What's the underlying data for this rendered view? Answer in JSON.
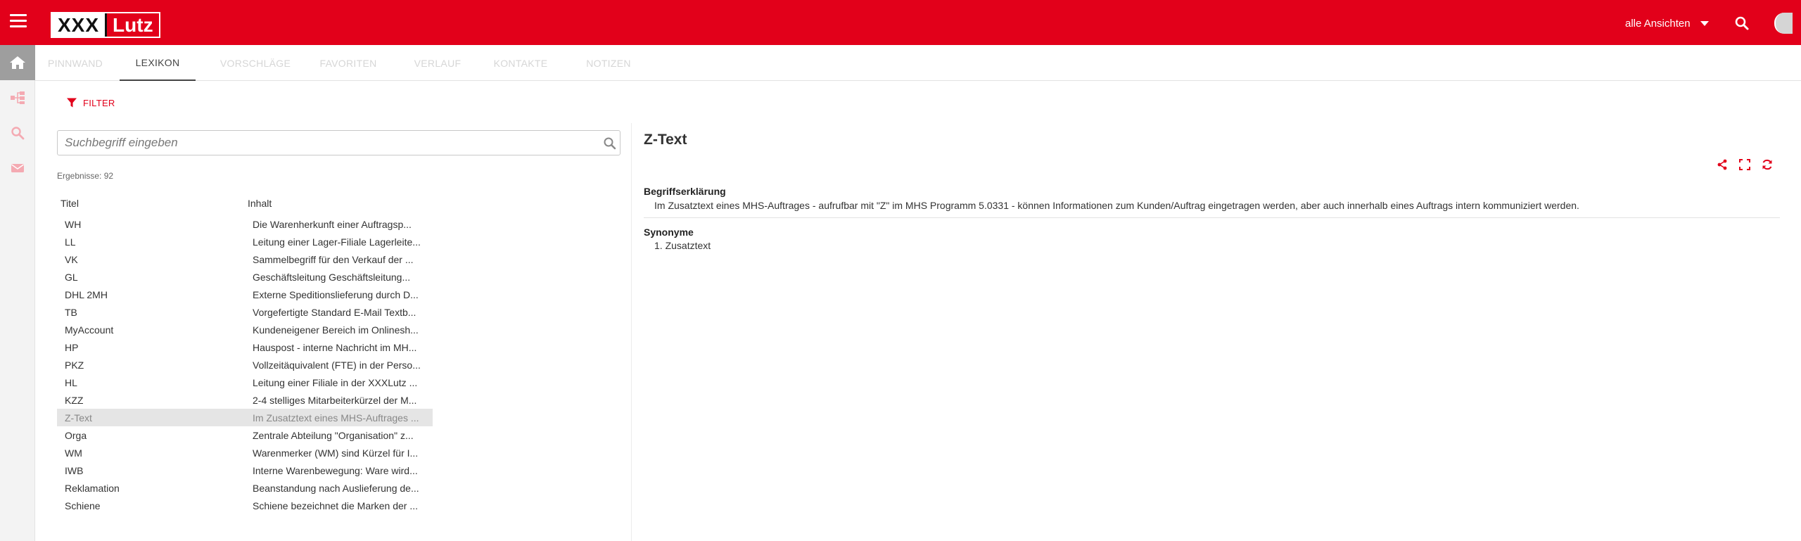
{
  "header": {
    "logo_part1": "XXX",
    "logo_part2": "Lutz",
    "views_label": "alle Ansichten"
  },
  "tabs": [
    {
      "label": "PINNWAND"
    },
    {
      "label": "LEXIKON"
    },
    {
      "label": "VORSCHLÄGE"
    },
    {
      "label": "FAVORITEN"
    },
    {
      "label": "VERLAUF"
    },
    {
      "label": "KONTAKTE"
    },
    {
      "label": "NOTIZEN"
    }
  ],
  "toolbar": {
    "filter_label": "FILTER"
  },
  "search": {
    "placeholder": "Suchbegriff eingeben",
    "value": ""
  },
  "results_label": "Ergebnisse: 92",
  "list": {
    "col_title": "Titel",
    "col_content": "Inhalt",
    "rows": [
      {
        "title": "WH",
        "content": "Die Warenherkunft einer Auftragsp..."
      },
      {
        "title": "LL",
        "content": "Leitung einer Lager-Filiale Lagerleite..."
      },
      {
        "title": "VK",
        "content": "Sammelbegriff für den Verkauf der ..."
      },
      {
        "title": "GL",
        "content": "Geschäftsleitung Geschäftsleitung..."
      },
      {
        "title": "DHL 2MH",
        "content": "Externe Speditionslieferung durch D..."
      },
      {
        "title": "TB",
        "content": "Vorgefertigte Standard E-Mail Textb..."
      },
      {
        "title": "MyAccount",
        "content": "Kundeneigener Bereich im Onlinesh..."
      },
      {
        "title": "HP",
        "content": "Hauspost - interne Nachricht im MH..."
      },
      {
        "title": "PKZ",
        "content": "Vollzeitäquivalent (FTE) in der Perso..."
      },
      {
        "title": "HL",
        "content": "Leitung einer Filiale in der XXXLutz ..."
      },
      {
        "title": "KZZ",
        "content": "2-4 stelliges Mitarbeiterkürzel der M..."
      },
      {
        "title": "Z-Text",
        "content": "Im Zusatztext eines MHS-Auftrages ..."
      },
      {
        "title": "Orga",
        "content": "Zentrale Abteilung \"Organisation\" z..."
      },
      {
        "title": "WM",
        "content": "Warenmerker (WM) sind Kürzel für I..."
      },
      {
        "title": "IWB",
        "content": "Interne Warenbewegung: Ware wird..."
      },
      {
        "title": "Reklamation",
        "content": "Beanstandung nach Auslieferung de..."
      },
      {
        "title": "Schiene",
        "content": "Schiene bezeichnet die Marken der ..."
      }
    ],
    "selected_index": 11
  },
  "detail": {
    "title": "Z-Text",
    "definition_label": "Begriffserklärung",
    "definition_text": "Im Zusatztext eines MHS-Auftrages - aufrufbar mit \"Z\" im MHS Programm 5.0331 - können Informationen zum Kunden/Auftrag eingetragen werden, aber auch innerhalb eines Auftrags intern kommuniziert werden.",
    "synonyms_label": "Synonyme",
    "synonyms": [
      "1. Zusatztext"
    ]
  },
  "icons": {
    "menu": "hamburger-menu-icon",
    "views_dropdown": "caret-down-icon",
    "header_search": "search-icon",
    "rail": [
      "home-icon",
      "sitemap-icon",
      "search-icon",
      "mail-icon"
    ],
    "filter": "filter-funnel-icon",
    "search_box": "magnifier-icon",
    "detail_actions": [
      "share-icon",
      "fullscreen-icon",
      "refresh-icon"
    ]
  },
  "colors": {
    "brand_red": "#e2001a",
    "rail_active": "#9e9e9e",
    "tab_inactive": "#d6d6d6",
    "tab_active": "#444444",
    "selected_row": "#e5e5e5"
  }
}
